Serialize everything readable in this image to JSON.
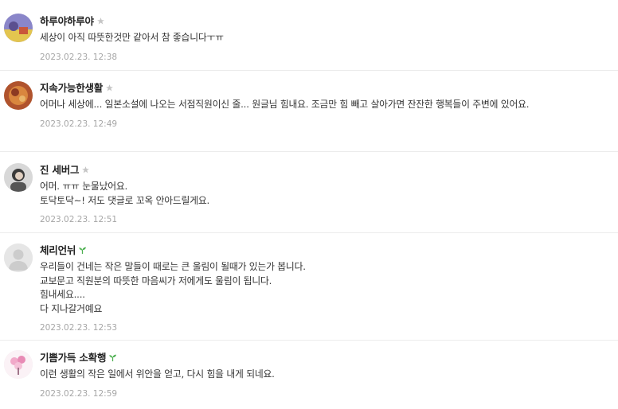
{
  "comments": [
    {
      "nickname": "하루야하루야",
      "badge": "manager-crown-icon",
      "text": "세상이 아직 따뜻한것만 같아서 참 좋습니다ㅜㅠ",
      "date": "2023.02.23. 12:38"
    },
    {
      "nickname": "지속가능한생활",
      "badge": "manager-crown-icon",
      "text": "어머나 세상에... 일본소설에 나오는 서점직원이신 줄... 원글님 힘내요. 조금만 힘 빼고 살아가면 잔잔한 행복들이 주변에 있어요.",
      "date": "2023.02.23. 12:49"
    },
    {
      "nickname": "진 세버그",
      "badge": "manager-crown-icon",
      "text": "어머. ㅠㅠ 눈물났어요.\n토닥토닥~! 저도 댓글로 꼬옥 안아드릴게요.",
      "date": "2023.02.23. 12:51"
    },
    {
      "nickname": "체리언뉘",
      "badge": "sprout-icon",
      "text": "우리들이 건네는 작은 말들이 때로는 큰 울림이 될때가 있는가 봅니다.\n교보문고 직원분의 따뜻한 마음씨가 저에게도 울림이 됩니다.\n힘내세요....\n다 지나갈거예요",
      "date": "2023.02.23. 12:53"
    },
    {
      "nickname": "기쁨가득 소확행",
      "badge": "sprout-icon",
      "text": "이런 생활의 작은 일에서 위안을 얻고, 다시 힘을 내게 되네요.",
      "date": "2023.02.23. 12:59"
    }
  ],
  "colors": {
    "nickname": "#222222",
    "text": "#333333",
    "date": "#a6a6a6",
    "divider": "#ececec",
    "crown_badge": "#c7c7c7",
    "sprout_badge": "#4caf50"
  }
}
